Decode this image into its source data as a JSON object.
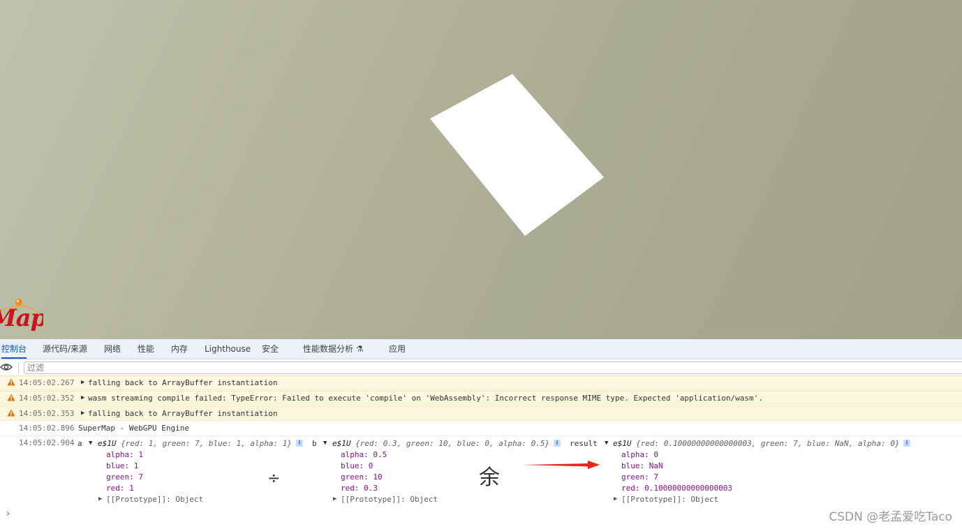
{
  "viewport": {
    "background": "#b0b297",
    "quad_color": "#ffffff",
    "logo": {
      "text": "Map",
      "color": "#c8141b"
    }
  },
  "devtools": {
    "tabs": [
      {
        "label": "控制台",
        "active": true
      },
      {
        "label": "源代码/来源"
      },
      {
        "label": "网络"
      },
      {
        "label": "性能"
      },
      {
        "label": "内存"
      },
      {
        "label": "Lighthouse"
      },
      {
        "label": "安全"
      },
      {
        "label": "性能数据分析 ⚗"
      },
      {
        "label": "应用"
      }
    ],
    "filter_placeholder": "过滤",
    "accent": "#0b57d0"
  },
  "console": {
    "messages": [
      {
        "level": "warning",
        "time": "14:05:02.267",
        "text": "falling back to ArrayBuffer instantiation"
      },
      {
        "level": "warning",
        "time": "14:05:02.352",
        "text": "wasm streaming compile failed: TypeError: Failed to execute 'compile' on 'WebAssembly': Incorrect response MIME type. Expected 'application/wasm'."
      },
      {
        "level": "warning",
        "time": "14:05:02.353",
        "text": "falling back to ArrayBuffer instantiation"
      },
      {
        "level": "info",
        "time": "14:05:02.896",
        "text": "SuperMap - WebGPU Engine"
      }
    ],
    "log": {
      "time": "14:05:02.904",
      "a": {
        "label": "a",
        "class_name": "e$1U",
        "preview": "{red: 1, green: 7, blue: 1, alpha: 1}",
        "props": [
          "alpha: 1",
          "blue: 1",
          "green: 7",
          "red: 1"
        ],
        "prototype": "[[Prototype]]: Object"
      },
      "b": {
        "label": "b",
        "class_name": "e$1U",
        "preview": "{red: 0.3, green: 10, blue: 0, alpha: 0.5}",
        "props": [
          "alpha: 0.5",
          "blue: 0",
          "green: 10",
          "red: 0.3"
        ],
        "prototype": "[[Prototype]]: Object"
      },
      "result": {
        "label": "result",
        "class_name": "e$1U",
        "preview": "{red: 0.10000000000000003, green: 7, blue: NaN, alpha: 0}",
        "props": [
          "alpha: 0",
          "blue: NaN",
          "green: 7",
          "red: 0.10000000000000003"
        ],
        "prototype": "[[Prototype]]: Object"
      }
    },
    "annotations": {
      "divide": "÷",
      "remainder": "余",
      "arrow_color": "#e8271b"
    },
    "prompt": "›"
  },
  "watermark": "CSDN @老孟爱吃Taco"
}
